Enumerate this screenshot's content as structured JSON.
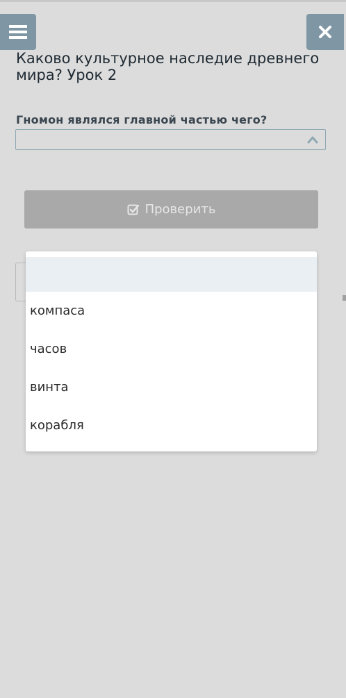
{
  "header": {
    "menu_icon": "hamburger-menu-icon",
    "close_icon": "close-x-icon",
    "title": "Каково культурное наследие древнего мира? Урок 2"
  },
  "question": {
    "text": "Гномон являлся главной частью чего?",
    "selected_value": ""
  },
  "check_button": {
    "label": "Проверить",
    "icon": "checkbox-check-icon"
  },
  "dropdown": {
    "options": [
      "",
      "компаса",
      "часов",
      "винта",
      "корабля"
    ]
  },
  "colors": {
    "background": "#dcdcdc",
    "header_button": "#7f97a5",
    "check_button": "#a9a9a9",
    "select_border": "#8fa8b3",
    "highlight_option": "#e9eff3"
  }
}
